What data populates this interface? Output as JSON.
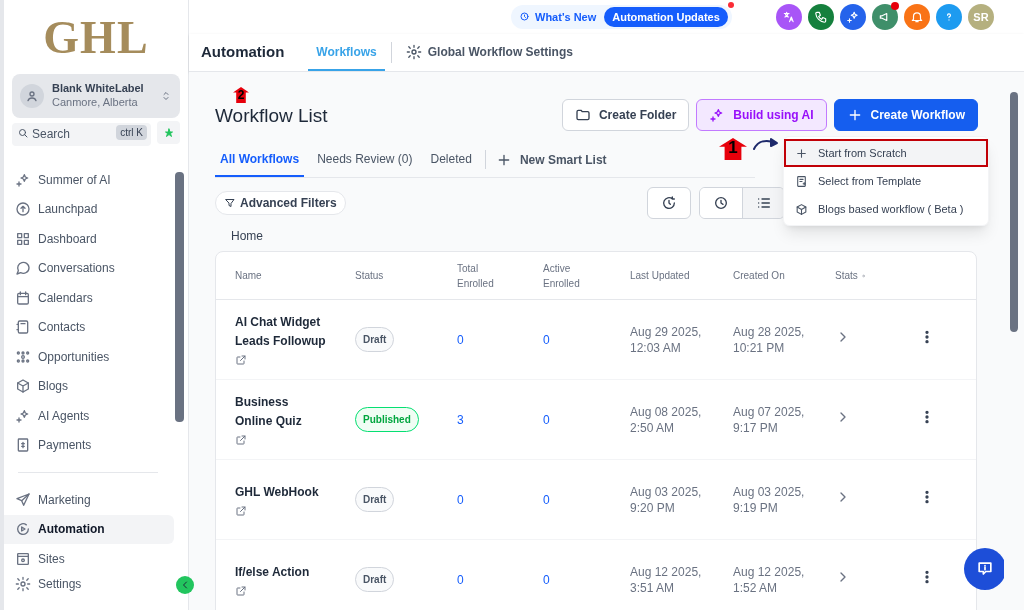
{
  "sidebar": {
    "logo": "GHL",
    "account": {
      "name": "Blank WhiteLabel",
      "location": "Canmore, Alberta"
    },
    "search": {
      "placeholder": "Search",
      "shortcut": "ctrl K"
    },
    "items": [
      {
        "label": "Summer of AI",
        "selected": false
      },
      {
        "label": "Launchpad",
        "selected": false
      },
      {
        "label": "Dashboard",
        "selected": false
      },
      {
        "label": "Conversations",
        "selected": false
      },
      {
        "label": "Calendars",
        "selected": false
      },
      {
        "label": "Contacts",
        "selected": false
      },
      {
        "label": "Opportunities",
        "selected": false
      },
      {
        "label": "Blogs",
        "selected": false
      },
      {
        "label": "AI Agents",
        "selected": false
      },
      {
        "label": "Payments",
        "selected": false
      }
    ],
    "bottom_items": [
      {
        "label": "Marketing",
        "selected": false
      },
      {
        "label": "Automation",
        "selected": true
      },
      {
        "label": "Sites",
        "selected": false
      },
      {
        "label": "Settings",
        "selected": false
      }
    ]
  },
  "top_bar": {
    "whats_new": "What's New",
    "updates_badge": "Automation Updates",
    "avatar": "SR"
  },
  "header": {
    "title": "Automation",
    "tabs": [
      {
        "label": "Workflows",
        "selected": true
      },
      {
        "label": "Global Workflow Settings",
        "selected": false
      }
    ]
  },
  "page": {
    "title": "Workflow List",
    "buttons": [
      "Create Folder",
      "Build using AI",
      "Create Workflow"
    ],
    "tabs": [
      {
        "label": "All Workflows",
        "selected": true
      },
      {
        "label": "Needs Review (0)",
        "selected": false
      },
      {
        "label": "Deleted",
        "selected": false
      }
    ],
    "new_smart_list": "New Smart List",
    "advanced_filters": "Advanced Filters",
    "breadcrumb": "Home",
    "menu": [
      {
        "label": "Start from Scratch",
        "selected": true
      },
      {
        "label": "Select from Template",
        "selected": false
      },
      {
        "label": "Blogs based workflow ( Beta )",
        "selected": false
      }
    ],
    "annotations": [
      "1",
      "2"
    ]
  },
  "table": {
    "columns": [
      "Name",
      "Status",
      "Total Enrolled",
      "Active Enrolled",
      "Last Updated",
      "Created On",
      "Stats"
    ],
    "rows": [
      {
        "name": "AI Chat Widget Leads Followup",
        "status": {
          "label": "Draft",
          "kind": "draft"
        },
        "total": "0",
        "active": "0",
        "last_updated": "Aug 29 2025, 12:03 AM",
        "created_on": "Aug 28 2025, 10:21 PM"
      },
      {
        "name": "Business Online Quiz",
        "status": {
          "label": "Published",
          "kind": "published"
        },
        "total": "3",
        "active": "0",
        "last_updated": "Aug 08 2025, 2:50 AM",
        "created_on": "Aug 07 2025, 9:17 PM"
      },
      {
        "name": "GHL WebHook",
        "status": {
          "label": "Draft",
          "kind": "draft"
        },
        "total": "0",
        "active": "0",
        "last_updated": "Aug 03 2025, 9:20 PM",
        "created_on": "Aug 03 2025, 9:19 PM"
      },
      {
        "name": "If/else Action",
        "status": {
          "label": "Draft",
          "kind": "draft"
        },
        "total": "0",
        "active": "0",
        "last_updated": "Aug 12 2025, 3:51 AM",
        "created_on": "Aug 12 2025, 1:52 AM"
      }
    ]
  }
}
